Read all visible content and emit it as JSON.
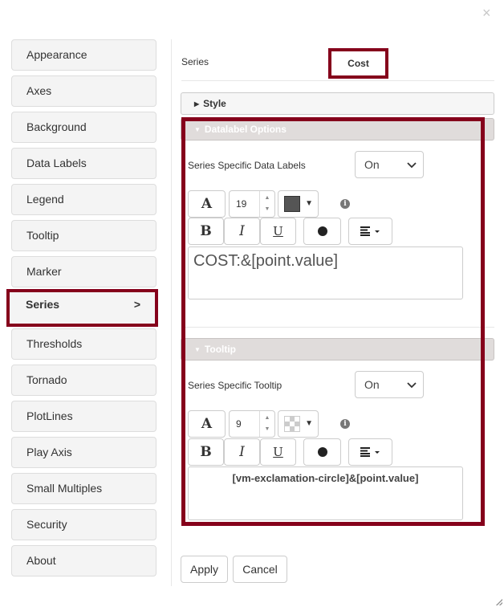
{
  "dialog": {
    "close_icon": "×"
  },
  "sidebar": {
    "items": [
      {
        "label": "Appearance"
      },
      {
        "label": "Axes"
      },
      {
        "label": "Background"
      },
      {
        "label": "Data Labels"
      },
      {
        "label": "Legend"
      },
      {
        "label": "Tooltip"
      },
      {
        "label": "Marker"
      },
      {
        "label": "Series",
        "active": true,
        "chevron": ">"
      },
      {
        "label": "Thresholds"
      },
      {
        "label": "Tornado"
      },
      {
        "label": "PlotLines"
      },
      {
        "label": "Play Axis"
      },
      {
        "label": "Small Multiples"
      },
      {
        "label": "Security"
      },
      {
        "label": "About"
      }
    ]
  },
  "series": {
    "label": "Series",
    "value": "Cost"
  },
  "sections": {
    "style": {
      "title": "Style",
      "expanded": false
    },
    "datalabel": {
      "title": "Datalabel Options",
      "expanded": true,
      "toggle_label": "Series Specific Data Labels",
      "toggle_value": "On",
      "font_icon": "A",
      "font_size": "19",
      "color": "#555555",
      "bold": "B",
      "italic": "I",
      "underline": "U",
      "text": "COST:&[point.value]"
    },
    "tooltip": {
      "title": "Tooltip",
      "expanded": true,
      "toggle_label": "Series Specific Tooltip",
      "toggle_value": "On",
      "font_icon": "A",
      "font_size": "9",
      "color": "transparent",
      "bold": "B",
      "italic": "I",
      "underline": "U",
      "text": "[vm-exclamation-circle]&[point.value]"
    }
  },
  "icons": {
    "info": "i",
    "dropdown": "▼",
    "spin_up": "▲",
    "spin_down": "▼",
    "triangle_right": "▶",
    "triangle_down": "▼"
  },
  "footer": {
    "apply_label": "Apply",
    "cancel_label": "Cancel"
  },
  "accent_color": "#85001b"
}
